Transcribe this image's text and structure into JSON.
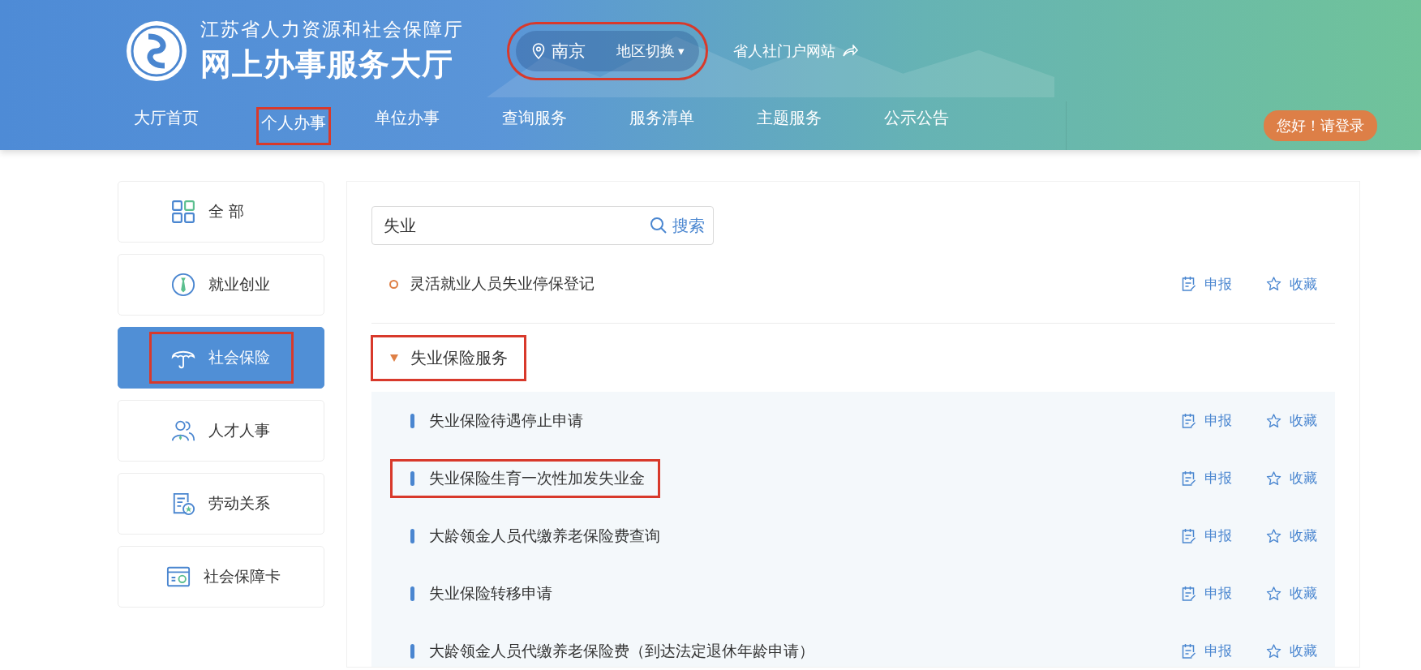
{
  "header": {
    "org_name": "江苏省人力资源和社会保障厅",
    "hall_name": "网上办事服务大厅",
    "location": {
      "city": "南京",
      "switch_label": "地区切换",
      "caret": "▾",
      "highlighted": true
    },
    "portal_link": "省人社门户网站",
    "login_button": "您好！请登录"
  },
  "nav": [
    {
      "label": "大厅首页",
      "highlighted": false
    },
    {
      "label": "个人办事",
      "highlighted": true
    },
    {
      "label": "单位办事",
      "highlighted": false
    },
    {
      "label": "查询服务",
      "highlighted": false
    },
    {
      "label": "服务清单",
      "highlighted": false
    },
    {
      "label": "主题服务",
      "highlighted": false
    },
    {
      "label": "公示公告",
      "highlighted": false
    }
  ],
  "sidebar": [
    {
      "label": "全 部",
      "selected": false,
      "highlighted": false
    },
    {
      "label": "就业创业",
      "selected": false,
      "highlighted": false
    },
    {
      "label": "社会保险",
      "selected": true,
      "highlighted": true
    },
    {
      "label": "人才人事",
      "selected": false,
      "highlighted": false
    },
    {
      "label": "劳动关系",
      "selected": false,
      "highlighted": false
    },
    {
      "label": "社会保障卡",
      "selected": false,
      "highlighted": false
    }
  ],
  "search": {
    "value": "失业",
    "button": "搜索"
  },
  "items": [
    {
      "kind": "item",
      "title": "灵活就业人员失业停保登记",
      "apply": "申报",
      "favorite": "收藏"
    },
    {
      "kind": "group",
      "title": "失业保险服务",
      "expanded": true,
      "highlighted": true,
      "children": [
        {
          "title": "失业保险待遇停止申请",
          "apply": "申报",
          "favorite": "收藏",
          "highlighted": false
        },
        {
          "title": "失业保险生育一次性加发失业金",
          "apply": "申报",
          "favorite": "收藏",
          "highlighted": true
        },
        {
          "title": "大龄领金人员代缴养老保险费查询",
          "apply": "申报",
          "favorite": "收藏",
          "highlighted": false
        },
        {
          "title": "失业保险转移申请",
          "apply": "申报",
          "favorite": "收藏",
          "highlighted": false
        },
        {
          "title": "大龄领金人员代缴养老保险费（到达法定退休年龄申请）",
          "apply": "申报",
          "favorite": "收藏",
          "highlighted": false
        }
      ]
    }
  ]
}
